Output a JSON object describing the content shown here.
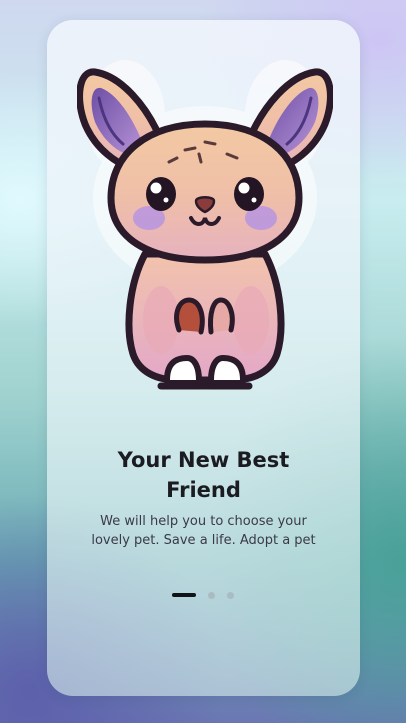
{
  "onboarding": {
    "illustration": "cute-bunny-mascot-illustration",
    "title_line1": "Your New Best",
    "title_line2": "Friend",
    "subtitle_line1": "We will help you to choose your",
    "subtitle_line2": "lovely pet. Save a life. Adopt a pet",
    "pagination": {
      "total": 3,
      "current": 1
    }
  },
  "colors": {
    "title": "#1b1b22",
    "subtitle": "#3a3a46",
    "dot_active": "#111417",
    "dot_inactive": "#a9bcc2",
    "bunny_fur": "#f0c1a0",
    "bunny_outline": "#2a1a2a",
    "ear_inner": "#8b6ab8"
  }
}
